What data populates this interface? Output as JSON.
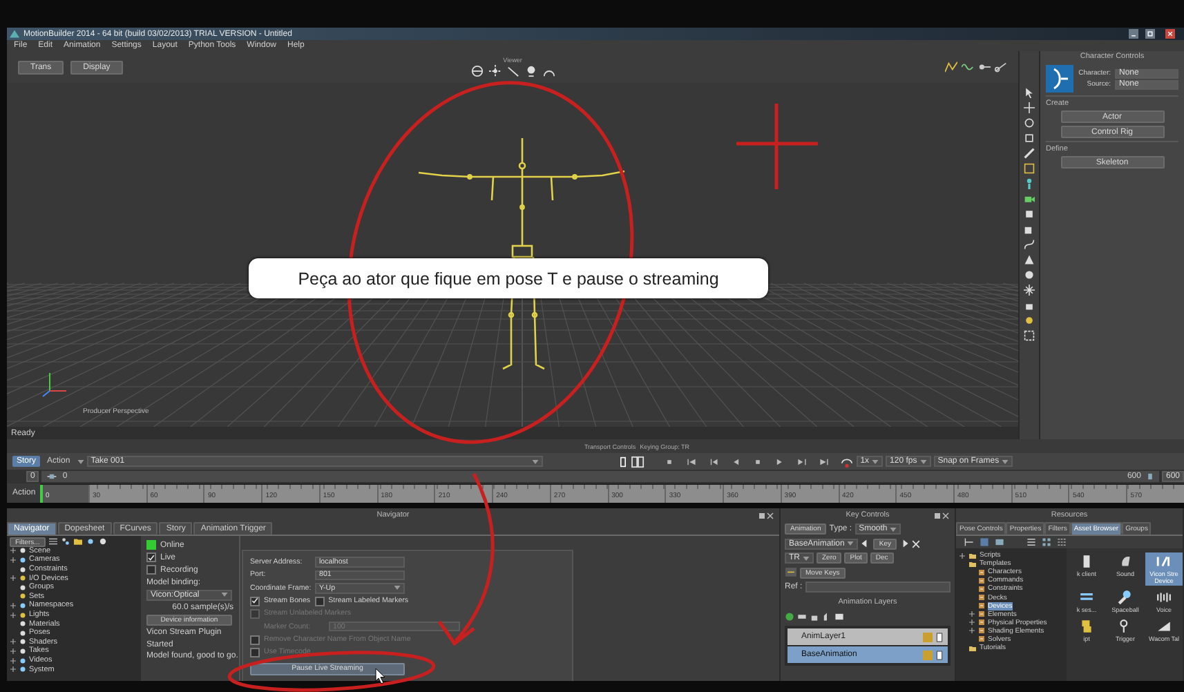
{
  "window": {
    "title": "MotionBuilder 2014 - 64 bit (build 03/02/2013) TRIAL VERSION - Untitled"
  },
  "menu": [
    "File",
    "Edit",
    "Animation",
    "Settings",
    "Layout",
    "Python Tools",
    "Window",
    "Help"
  ],
  "viewer": {
    "title": "Viewer",
    "buttons": [
      "Trans",
      "Display"
    ],
    "camera": "Producer Perspective",
    "status": "Ready"
  },
  "character_controls": {
    "title": "Character Controls",
    "character_label": "Character:",
    "character_value": "None",
    "source_label": "Source:",
    "source_value": "None",
    "create_label": "Create",
    "create_buttons": [
      "Actor",
      "Control Rig"
    ],
    "define_label": "Define",
    "define_buttons": [
      "Skeleton"
    ]
  },
  "caption": "Peça ao ator que fique em pose T e pause o streaming",
  "transport": {
    "title": "Transport Controls",
    "keying_group": "Keying Group: TR",
    "modes": [
      {
        "label": "Story",
        "selected": true
      },
      {
        "label": "Action",
        "selected": false
      }
    ],
    "take": "Take 001",
    "speed": "1x",
    "fps": "120 fps",
    "snap": "Snap on Frames",
    "start": "0",
    "current": "0",
    "end": "600",
    "end_field": "600"
  },
  "timeline": {
    "label": "Action",
    "ticks": [
      "0",
      "30",
      "60",
      "90",
      "120",
      "150",
      "180",
      "210",
      "240",
      "270",
      "300",
      "330",
      "360",
      "390",
      "420",
      "450",
      "480",
      "510",
      "540",
      "570"
    ]
  },
  "navigator": {
    "title": "Navigator",
    "tabs": [
      {
        "label": "Navigator",
        "selected": true
      },
      {
        "label": "Dopesheet",
        "selected": false
      },
      {
        "label": "FCurves",
        "selected": false
      },
      {
        "label": "Story",
        "selected": false
      },
      {
        "label": "Animation Trigger",
        "selected": false
      }
    ],
    "filter_button": "Filters...",
    "tree": [
      {
        "label": "Scene",
        "expandable": true,
        "selected": false
      },
      {
        "label": "Cameras",
        "expandable": true,
        "selected": false
      },
      {
        "label": "Constraints",
        "expandable": false,
        "selected": false
      },
      {
        "label": "I/O Devices",
        "expandable": true,
        "selected": false
      },
      {
        "label": "Groups",
        "expandable": false,
        "selected": false
      },
      {
        "label": "Sets",
        "expandable": false,
        "selected": false
      },
      {
        "label": "Namespaces",
        "expandable": true,
        "selected": false
      },
      {
        "label": "Lights",
        "expandable": true,
        "selected": false
      },
      {
        "label": "Materials",
        "expandable": false,
        "selected": false
      },
      {
        "label": "Poses",
        "expandable": false,
        "selected": false
      },
      {
        "label": "Shaders",
        "expandable": true,
        "selected": false
      },
      {
        "label": "Takes",
        "expandable": true,
        "selected": false
      },
      {
        "label": "Videos",
        "expandable": true,
        "selected": false
      },
      {
        "label": "System",
        "expandable": true,
        "selected": false
      }
    ],
    "device": {
      "online": {
        "label": "Online",
        "on": true
      },
      "live": {
        "label": "Live",
        "checked": true
      },
      "recording": {
        "label": "Recording",
        "checked": false
      },
      "binding_label": "Model binding:",
      "binding_value": "Vicon:Optical",
      "rate": "60.0 sample(s)/s",
      "info_button": "Device information",
      "plugin": "Vicon Stream Plugin",
      "state": "Started",
      "message": "Model found, good to go."
    },
    "settings": {
      "server_label": "Server Address:",
      "server_value": "localhost",
      "port_label": "Port:",
      "port_value": "801",
      "frame_label": "Coordinate Frame:",
      "frame_value": "Y-Up",
      "options": [
        {
          "label": "Stream Bones",
          "checked": true,
          "disabled": false
        },
        {
          "label": "Stream Labeled Markers",
          "checked": false,
          "disabled": false
        }
      ],
      "unlabeled": {
        "label": "Stream Unlabeled Markers",
        "checked": false,
        "disabled": true
      },
      "marker_count_label": "Marker Count:",
      "marker_count": "100",
      "marker_count_disabled": true,
      "flags": [
        {
          "label": "Remove Character Name From Object Name",
          "checked": false
        },
        {
          "label": "Use Timecode",
          "checked": false
        }
      ],
      "pause_button": "Pause Live Streaming"
    }
  },
  "key_controls": {
    "title": "Key Controls",
    "animation_button": "Animation",
    "type_label": "Type :",
    "type_value": "Smooth",
    "layer_value": "BaseAnimation",
    "key_button": "Key",
    "filter_value": "TR",
    "buttons": [
      "Zero",
      "Plot",
      "Dec"
    ],
    "move_keys": "Move Keys",
    "ref_label": "Ref :",
    "layers_title": "Animation Layers",
    "layers": [
      {
        "name": "AnimLayer1",
        "selected": false
      },
      {
        "name": "BaseAnimation",
        "selected": true
      }
    ]
  },
  "resources": {
    "title": "Resources",
    "tabs": [
      {
        "label": "Pose Controls",
        "selected": false
      },
      {
        "label": "Properties",
        "selected": false
      },
      {
        "label": "Filters",
        "selected": false
      },
      {
        "label": "Asset Browser",
        "selected": true
      },
      {
        "label": "Groups",
        "selected": false
      }
    ],
    "tree": [
      {
        "label": "Scripts",
        "expandable": true,
        "selected": false
      },
      {
        "label": "Templates",
        "expandable": false,
        "selected": false,
        "children": [
          {
            "label": "Characters",
            "expandable": false,
            "selected": false
          },
          {
            "label": "Commands",
            "expandable": false,
            "selected": false
          },
          {
            "label": "Constraints",
            "expandable": false,
            "selected": false
          },
          {
            "label": "Decks",
            "expandable": false,
            "selected": false
          },
          {
            "label": "Devices",
            "expandable": false,
            "selected": true
          },
          {
            "label": "Elements",
            "expandable": true,
            "selected": false
          },
          {
            "label": "Physical Properties",
            "expandable": true,
            "selected": false
          },
          {
            "label": "Shading Elements",
            "expandable": true,
            "selected": false
          },
          {
            "label": "Solvers",
            "expandable": false,
            "selected": false
          }
        ]
      },
      {
        "label": "Tutorials",
        "expandable": false,
        "selected": false
      }
    ],
    "assets": [
      {
        "label": "k client",
        "selected": false
      },
      {
        "label": "Sound",
        "selected": false
      },
      {
        "label": "Vicon Stre Device",
        "selected": true
      },
      {
        "label": "k ses...",
        "selected": false
      },
      {
        "label": "Spaceball",
        "selected": false
      },
      {
        "label": "Voice",
        "selected": false
      },
      {
        "label": "ipt",
        "selected": false
      },
      {
        "label": "Trigger",
        "selected": false
      },
      {
        "label": "Wacom Tal",
        "selected": false
      }
    ]
  }
}
